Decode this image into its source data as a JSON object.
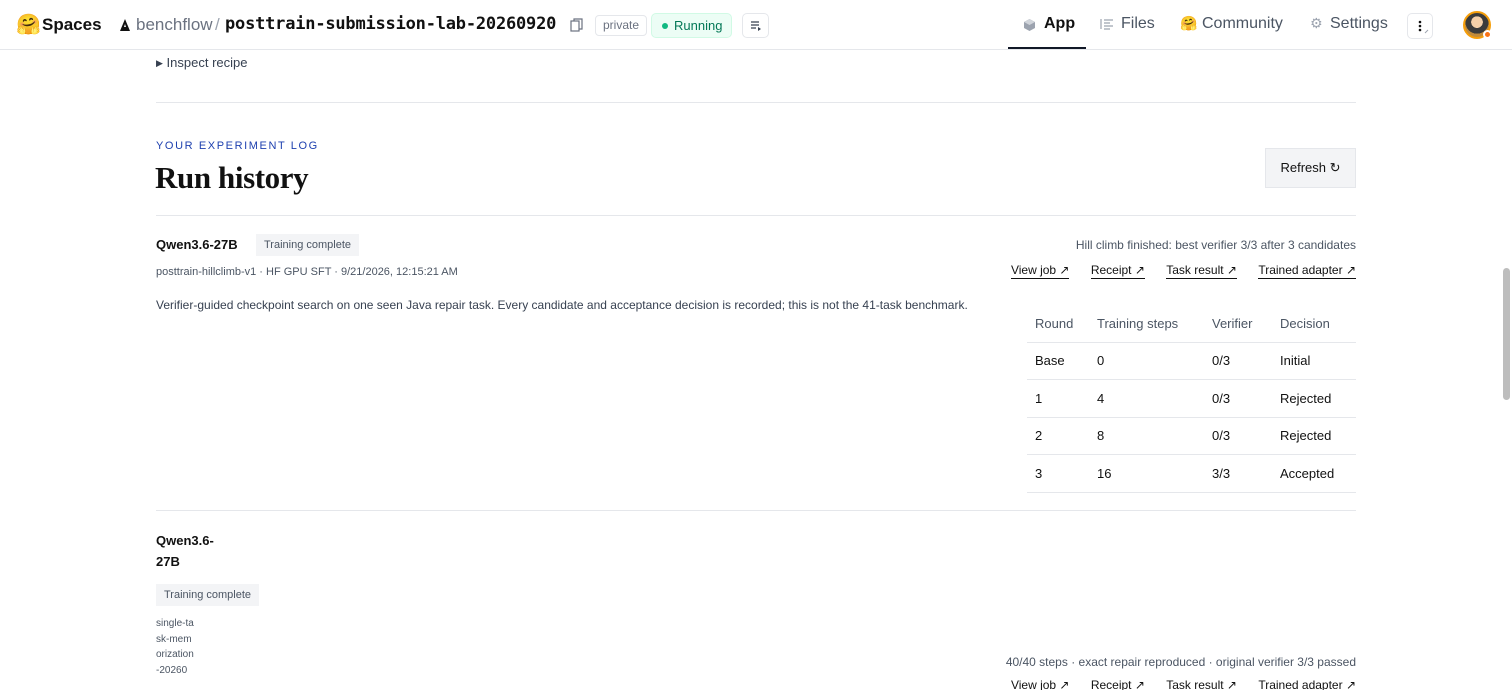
{
  "header": {
    "brand": "Spaces",
    "org": "benchflow",
    "separator": "/",
    "repo": "posttrain-submission-lab-20260920",
    "visibility": "private",
    "status": "Running",
    "nav": {
      "app": "App",
      "files": "Files",
      "community": "Community",
      "settings": "Settings"
    },
    "icons": {
      "logo": "hugging-face-icon",
      "copy": "copy-icon",
      "logs": "logs-icon",
      "more": "more-vertical-icon"
    }
  },
  "content": {
    "inspect_label": "Inspect recipe",
    "eyebrow": "YOUR EXPERIMENT LOG",
    "title": "Run history",
    "refresh_label": "Refresh ↻",
    "runs": [
      {
        "model": "Qwen3.6-27B",
        "status": "Training complete",
        "meta": "posttrain-hillclimb-v1 · HF GPU SFT · 9/21/2026, 12:15:21 AM",
        "description": "Verifier-guided checkpoint search on one seen Java repair task. Every candidate and acceptance decision is recorded; this is not the 41-task benchmark.",
        "summary": "Hill climb finished: best verifier 3/3 after 3 candidates",
        "links": [
          "View job ↗",
          "Receipt ↗",
          "Task result ↗",
          "Trained adapter ↗"
        ],
        "table": {
          "headers": [
            "Round",
            "Training steps",
            "Verifier",
            "Decision"
          ],
          "rows": [
            [
              "Base",
              "0",
              "0/3",
              "Initial"
            ],
            [
              "1",
              "4",
              "0/3",
              "Rejected"
            ],
            [
              "2",
              "8",
              "0/3",
              "Rejected"
            ],
            [
              "3",
              "16",
              "3/3",
              "Accepted"
            ]
          ]
        }
      },
      {
        "model": "Qwen3.6-27B",
        "status": "Training complete",
        "meta": "single-task-memorization-20260",
        "summary": "40/40 steps · exact repair reproduced · original verifier 3/3 passed",
        "links": [
          "View job ↗",
          "Receipt ↗",
          "Task result ↗",
          "Trained adapter ↗"
        ]
      }
    ]
  },
  "colors": {
    "accent_blue": "#1e40af",
    "running_green": "#047857",
    "border": "#e5e7eb"
  }
}
